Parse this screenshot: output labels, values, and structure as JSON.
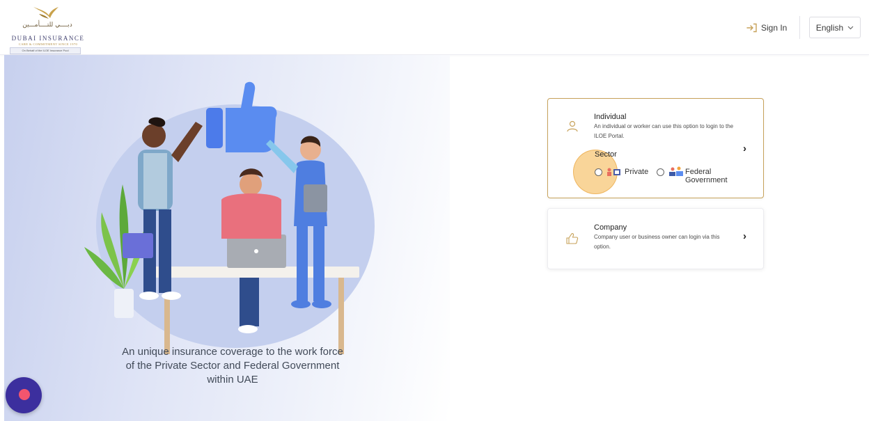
{
  "header": {
    "logo": {
      "arabic_name": "دبــــي للتــــأمـــين",
      "english_name": "DUBAI INSURANCE",
      "tagline": "CARE & COMMITMENT SINCE 1970",
      "badge": "On Behalf of the ILOE Insurance Pool"
    },
    "signin_label": "Sign In",
    "language": "English"
  },
  "hero": {
    "tagline": "An unique insurance coverage to the work force\nof the Private Sector and Federal Government\nwithin UAE"
  },
  "cards": {
    "individual": {
      "title": "Individual",
      "description": "An individual or worker can use this option to login to the ILOE Portal.",
      "sector_label": "Sector",
      "options": [
        {
          "label": "Private",
          "selected": false
        },
        {
          "label": "Federal Government",
          "selected": false
        }
      ]
    },
    "company": {
      "title": "Company",
      "description": "Company user or business owner can login via this option."
    }
  },
  "colors": {
    "accent_gold": "#c7a25a",
    "highlight": "#f4b246",
    "chat_button": "#3c2f9e",
    "chat_dot": "#f2556e"
  }
}
